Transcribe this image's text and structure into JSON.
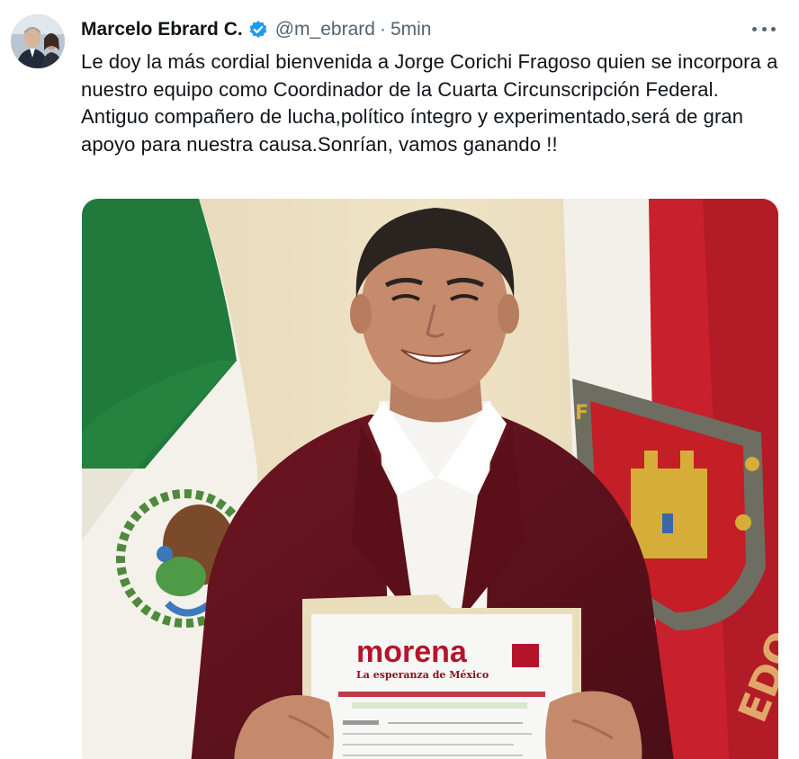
{
  "tweet": {
    "author_name": "Marcelo Ebrard C.",
    "handle": "@m_ebrard",
    "separator": "·",
    "time": "5min",
    "text": "Le doy la más cordial bienvenida a Jorge Corichi Fragoso quien se incorpora a nuestro equipo como Coordinador de la Cuarta Circunscripción Federal. Antiguo compañero de lucha,político íntegro y experimentado,será de gran apoyo para nuestra causa.Sonrían, vamos ganando !!"
  },
  "icons": {
    "verified": "verified-badge-icon",
    "more": "more-options-icon"
  },
  "photo": {
    "folder_logo": "morena",
    "folder_tagline": "La esperanza de México",
    "flag_text": "EDO"
  },
  "colors": {
    "verified_blue": "#1d9bf0",
    "text_primary": "#0f1419",
    "text_secondary": "#536471",
    "morena_red": "#b5152b"
  }
}
